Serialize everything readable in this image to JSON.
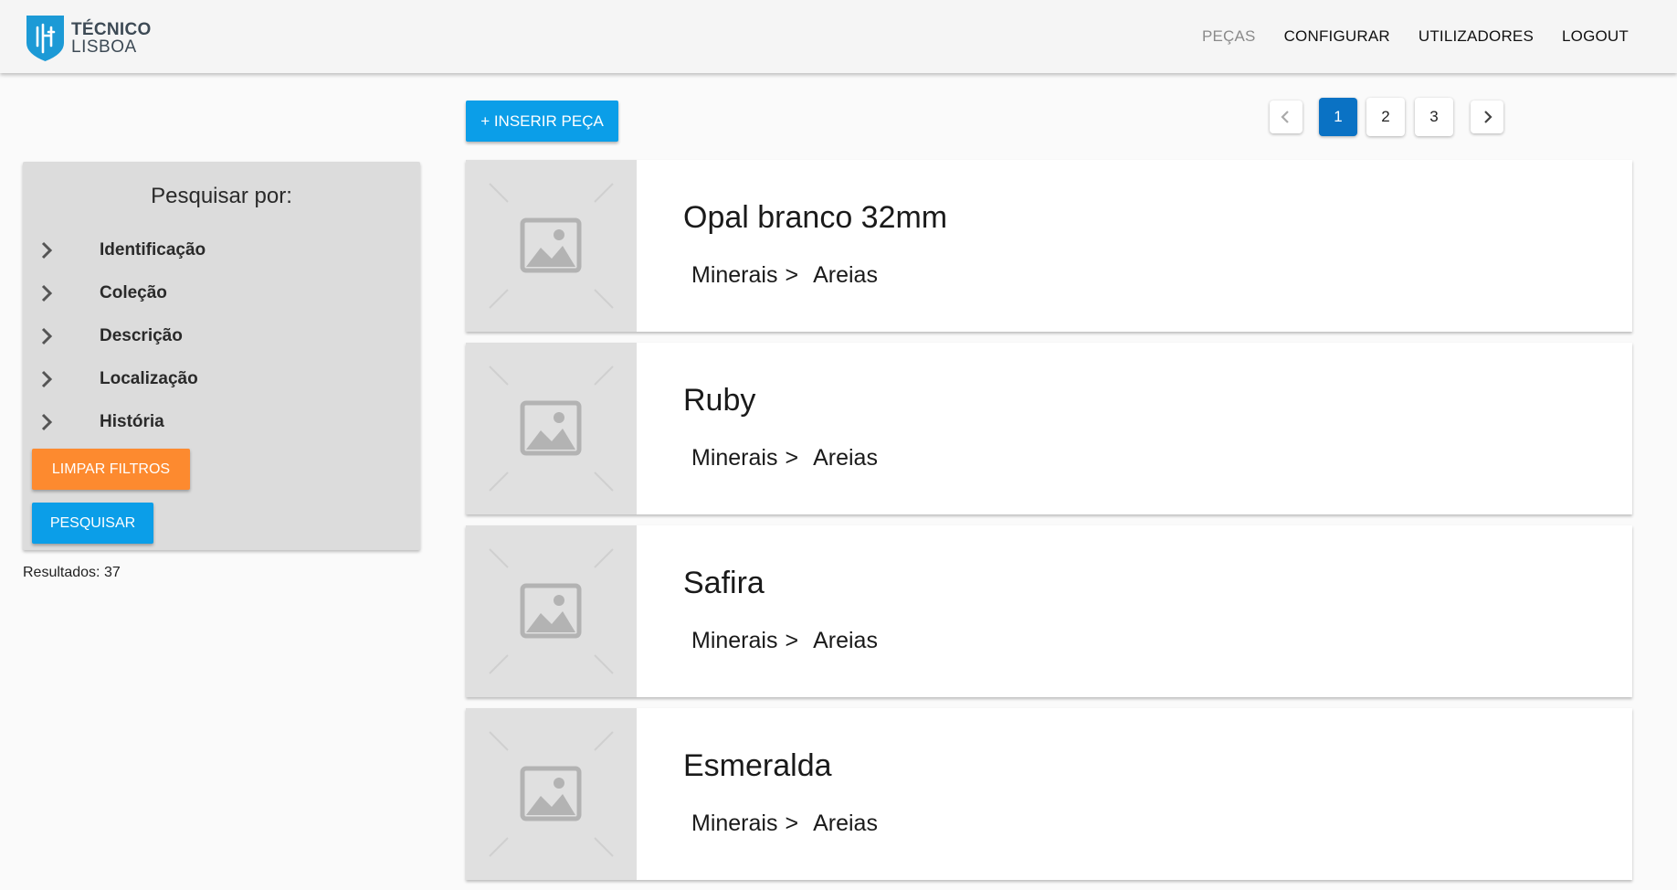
{
  "header": {
    "logo_line1": "TÉCNICO",
    "logo_line2": "LISBOA",
    "nav": [
      {
        "label": "PEÇAS",
        "active": true
      },
      {
        "label": "CONFIGURAR",
        "active": false
      },
      {
        "label": "UTILIZADORES",
        "active": false
      },
      {
        "label": "LOGOUT",
        "active": false
      }
    ]
  },
  "filters": {
    "title": "Pesquisar por:",
    "items": [
      {
        "label": "Identificação"
      },
      {
        "label": "Coleção"
      },
      {
        "label": "Descrição"
      },
      {
        "label": "Localização"
      },
      {
        "label": "História"
      }
    ],
    "clear_label": "LIMPAR FILTROS",
    "search_label": "PESQUISAR"
  },
  "results": "Resultados: 37",
  "toolbar": {
    "insert_label": "+ INSERIR PEÇA"
  },
  "pagination": {
    "pages": [
      "1",
      "2",
      "3"
    ],
    "current": "1"
  },
  "pieces": [
    {
      "name": "Opal branco 32mm",
      "category": "Minerais",
      "separator": ">",
      "subcategory": "Areias"
    },
    {
      "name": "Ruby",
      "category": "Minerais",
      "separator": ">",
      "subcategory": "Areias"
    },
    {
      "name": "Safira",
      "category": "Minerais",
      "separator": ">",
      "subcategory": "Areias"
    },
    {
      "name": "Esmeralda",
      "category": "Minerais",
      "separator": ">",
      "subcategory": "Areias"
    }
  ],
  "colors": {
    "primary": "#0b9ee8",
    "accent_orange": "#fd8a2f",
    "page_active": "#0a72c4",
    "logo_blue": "#1c9ad6"
  },
  "icons": {
    "logo": "ist-shield-logo",
    "filter_expand": "chevron-right-icon",
    "page_prev": "chevron-left-icon",
    "page_next": "chevron-right-icon",
    "thumb_placeholder": "image-placeholder-icon"
  }
}
